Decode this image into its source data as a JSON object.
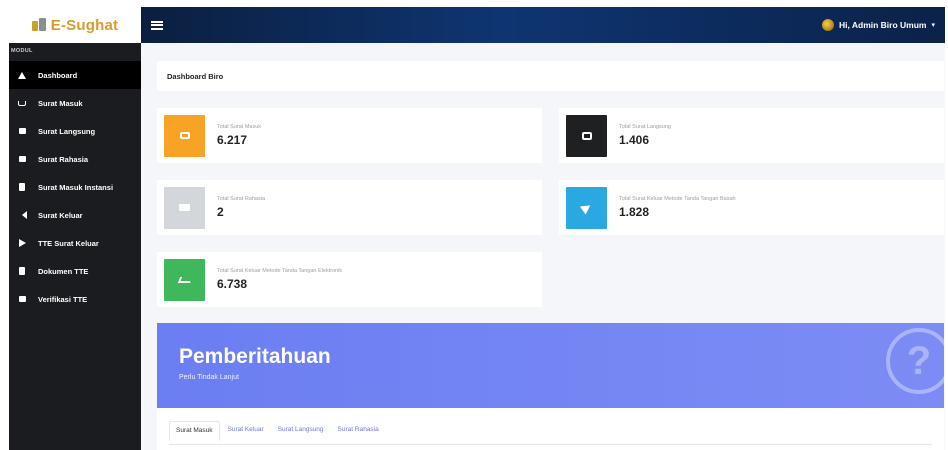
{
  "brand": {
    "name": "E-Sughat",
    "logo_icon": "building-books-icon"
  },
  "topbar": {
    "menu_icon": "hamburger-icon",
    "user_greeting": "Hi, Admin Biro Umum",
    "caret": "▾"
  },
  "sidebar": {
    "heading": "MODUL",
    "items": [
      {
        "label": "Dashboard",
        "icon": "home-icon",
        "active": true
      },
      {
        "label": "Surat Masuk",
        "icon": "inbox-icon",
        "active": false
      },
      {
        "label": "Surat Langsung",
        "icon": "tray-icon",
        "active": false
      },
      {
        "label": "Surat Rahasia",
        "icon": "envelope-icon",
        "active": false
      },
      {
        "label": "Surat Masuk Instansi",
        "icon": "document-icon",
        "active": false
      },
      {
        "label": "Surat Keluar",
        "icon": "send-icon",
        "active": false
      },
      {
        "label": "TTE Surat Keluar",
        "icon": "play-icon",
        "active": false
      },
      {
        "label": "Dokumen TTE",
        "icon": "document-icon",
        "active": false
      },
      {
        "label": "Verifikasi TTE",
        "icon": "verify-icon",
        "active": false
      }
    ]
  },
  "breadcrumb": {
    "title": "Dashboard Biro"
  },
  "stats": [
    {
      "label": "Total Surat Masuk",
      "value": "6.217",
      "color": "#f7a325",
      "icon": "inbox-icon"
    },
    {
      "label": "Total Surat Langsung",
      "value": "1.406",
      "color": "#1f2022",
      "icon": "tray-icon"
    },
    {
      "label": "Total Surat Rahasia",
      "value": "2",
      "color": "#d3d6da",
      "icon": "envelope-icon"
    },
    {
      "label": "Total Surat Keluar Metode Tanda Tangan Basah",
      "value": "1.828",
      "color": "#2aa8e0",
      "icon": "send-icon"
    },
    {
      "label": "Total Surat Keluar Metode Tanda Tangan Elektronik",
      "value": "6.738",
      "color": "#3fb85b",
      "icon": "signature-icon"
    }
  ],
  "banner": {
    "title": "Pemberitahuan",
    "subtitle": "Perlu Tindak Lanjut",
    "icon": "question-circle-icon",
    "icon_glyph": "?"
  },
  "tabs": [
    {
      "label": "Surat Masuk",
      "active": true
    },
    {
      "label": "Surat Keluar",
      "active": false
    },
    {
      "label": "Surat Langsung",
      "active": false
    },
    {
      "label": "Surat Rahasia",
      "active": false
    }
  ]
}
